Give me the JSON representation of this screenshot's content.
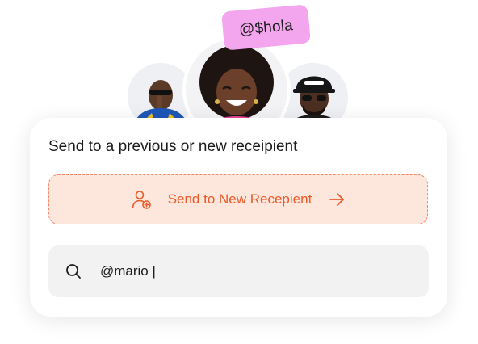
{
  "tag": {
    "text": "@$hola",
    "color": "#f3a6ee"
  },
  "avatars": {
    "left": "avatar-person-left",
    "center": "avatar-person-center",
    "right": "avatar-person-right"
  },
  "card": {
    "title": "Send to a previous or new receipient",
    "new_recipient": {
      "label": "Send to New Recepient",
      "icon": "add-user-icon",
      "arrow_icon": "arrow-right-icon",
      "accent": "#ec5a2a"
    },
    "search": {
      "icon": "search-icon",
      "value": "@mario |"
    }
  }
}
